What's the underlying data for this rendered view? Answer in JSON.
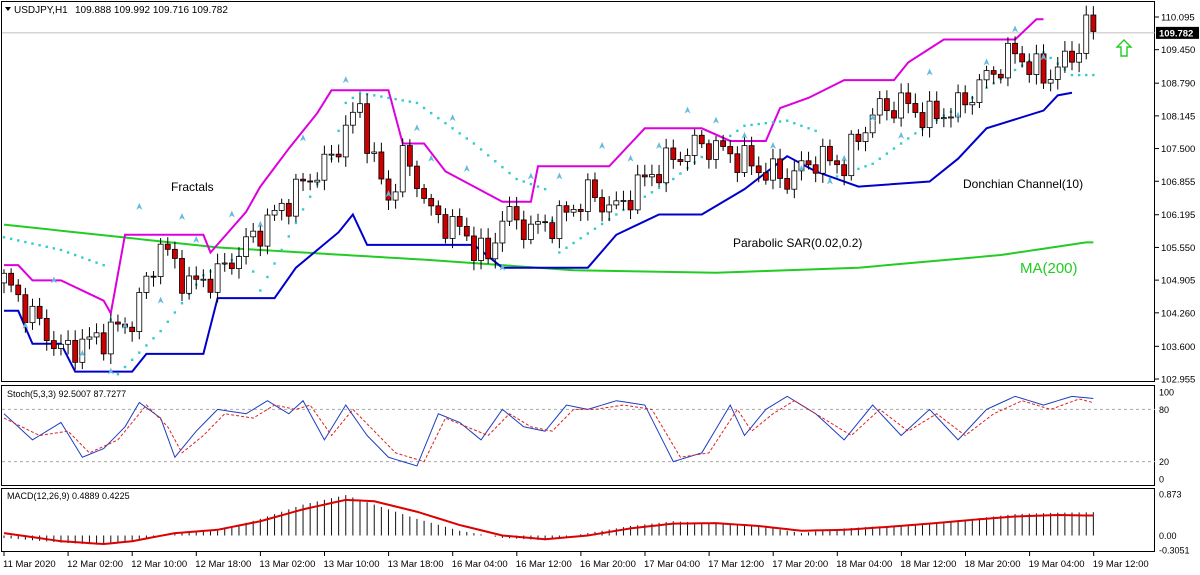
{
  "header": {
    "symbol": "USDJPY,H1",
    "ohlc": "109.888 109.992 109.716 109.782"
  },
  "annotations": {
    "fractals": "Fractals",
    "donchian": "Donchian Channel(10)",
    "sar": "Parabolic SAR(0.02,0.2)",
    "ma": "MA(200)"
  },
  "stoch": {
    "label": "Stoch(5,3,3) 92.5007 87.7277"
  },
  "macd": {
    "label": "MACD(12,26,9) 0.4889 0.4225"
  },
  "colors": {
    "bull": "#ffffff",
    "bear": "#cc0000",
    "donchian_upper": "#dd00dd",
    "donchian_lower": "#0000cc",
    "sar": "#33cccc",
    "ma": "#22cc22",
    "fractal": "#66bbdd",
    "stoch_main": "#1f3fbf",
    "stoch_signal": "#dd2222",
    "macd_hist": "#111111",
    "macd_signal": "#dd0000",
    "current_price_bg": "#000000",
    "arrow": "#22cc22"
  },
  "chart_data": {
    "type": "candlestick",
    "price_axis": {
      "ticks": [
        "110.095",
        "109.450",
        "108.790",
        "108.145",
        "107.500",
        "106.855",
        "106.195",
        "105.550",
        "104.905",
        "104.260",
        "103.600",
        "102.955"
      ],
      "current": "109.782",
      "range": [
        102.955,
        110.095
      ]
    },
    "x_axis": {
      "labels": [
        "11 Mar 2020",
        "12 Mar 02:00",
        "12 Mar 10:00",
        "12 Mar 18:00",
        "13 Mar 02:00",
        "13 Mar 10:00",
        "13 Mar 18:00",
        "16 Mar 04:00",
        "16 Mar 12:00",
        "16 Mar 20:00",
        "17 Mar 04:00",
        "17 Mar 12:00",
        "17 Mar 20:00",
        "18 Mar 04:00",
        "18 Mar 12:00",
        "18 Mar 20:00",
        "19 Mar 04:00",
        "19 Mar 12:00"
      ]
    },
    "candle_anchors": [
      [
        0,
        104.9
      ],
      [
        8,
        103.5
      ],
      [
        14,
        103.8
      ],
      [
        18,
        104.1
      ],
      [
        22,
        105.6
      ],
      [
        26,
        104.8
      ],
      [
        30,
        105.0
      ],
      [
        34,
        105.6
      ],
      [
        38,
        106.2
      ],
      [
        42,
        106.8
      ],
      [
        46,
        107.3
      ],
      [
        48,
        107.9
      ],
      [
        50,
        108.3
      ],
      [
        52,
        107.2
      ],
      [
        54,
        106.5
      ],
      [
        56,
        107.3
      ],
      [
        58,
        106.9
      ],
      [
        60,
        106.2
      ],
      [
        64,
        105.9
      ],
      [
        68,
        105.3
      ],
      [
        70,
        106.2
      ],
      [
        74,
        105.9
      ],
      [
        78,
        106.1
      ],
      [
        82,
        106.6
      ],
      [
        86,
        106.3
      ],
      [
        90,
        106.9
      ],
      [
        94,
        107.3
      ],
      [
        98,
        107.6
      ],
      [
        102,
        107.4
      ],
      [
        106,
        107.1
      ],
      [
        110,
        106.9
      ],
      [
        114,
        107.3
      ],
      [
        118,
        107.2
      ],
      [
        122,
        108.2
      ],
      [
        126,
        108.4
      ],
      [
        130,
        108.1
      ],
      [
        134,
        108.3
      ],
      [
        138,
        108.9
      ],
      [
        142,
        109.4
      ],
      [
        146,
        108.9
      ],
      [
        148,
        109.1
      ],
      [
        150,
        109.3
      ],
      [
        152,
        109.9
      ],
      [
        153,
        109.78
      ]
    ],
    "donchian_upper_anchors": [
      [
        0,
        105.2
      ],
      [
        2,
        105.2
      ],
      [
        4,
        104.9
      ],
      [
        8,
        104.9
      ],
      [
        14,
        104.5
      ],
      [
        15,
        104.25
      ],
      [
        17,
        105.8
      ],
      [
        28,
        105.8
      ],
      [
        29,
        105.45
      ],
      [
        34,
        106.25
      ],
      [
        36,
        106.75
      ],
      [
        40,
        107.5
      ],
      [
        44,
        108.2
      ],
      [
        46,
        108.65
      ],
      [
        54,
        108.65
      ],
      [
        56,
        107.6
      ],
      [
        59,
        107.6
      ],
      [
        62,
        107.05
      ],
      [
        70,
        106.45
      ],
      [
        74,
        106.45
      ],
      [
        75,
        107.15
      ],
      [
        85,
        107.15
      ],
      [
        90,
        107.9
      ],
      [
        98,
        107.9
      ],
      [
        102,
        107.65
      ],
      [
        107,
        107.65
      ],
      [
        109,
        108.3
      ],
      [
        113,
        108.5
      ],
      [
        118,
        108.85
      ],
      [
        125,
        108.85
      ],
      [
        127,
        109.2
      ],
      [
        132,
        109.65
      ],
      [
        142,
        109.65
      ],
      [
        145,
        110.05
      ],
      [
        146,
        110.05
      ]
    ],
    "donchian_lower_anchors": [
      [
        0,
        104.3
      ],
      [
        2,
        104.3
      ],
      [
        4,
        103.65
      ],
      [
        8,
        103.65
      ],
      [
        10,
        103.1
      ],
      [
        18,
        103.1
      ],
      [
        20,
        103.45
      ],
      [
        28,
        103.45
      ],
      [
        30,
        104.55
      ],
      [
        38,
        104.55
      ],
      [
        41,
        105.15
      ],
      [
        47,
        105.85
      ],
      [
        49,
        106.2
      ],
      [
        51,
        105.6
      ],
      [
        66,
        105.6
      ],
      [
        70,
        105.15
      ],
      [
        82,
        105.15
      ],
      [
        86,
        105.8
      ],
      [
        92,
        106.2
      ],
      [
        98,
        106.2
      ],
      [
        104,
        106.7
      ],
      [
        110,
        107.35
      ],
      [
        114,
        107.05
      ],
      [
        120,
        106.75
      ],
      [
        130,
        106.85
      ],
      [
        134,
        107.3
      ],
      [
        138,
        107.9
      ],
      [
        146,
        108.25
      ],
      [
        148,
        108.55
      ],
      [
        150,
        108.6
      ]
    ],
    "sar_anchors": [
      [
        0,
        105.75
      ],
      [
        8,
        105.5
      ],
      [
        14,
        105.2
      ],
      [
        16,
        103.05
      ],
      [
        22,
        103.9
      ],
      [
        28,
        105.0
      ],
      [
        34,
        105.45
      ],
      [
        36,
        104.7
      ],
      [
        42,
        106.3
      ],
      [
        46,
        107.3
      ],
      [
        48,
        108.4
      ],
      [
        50,
        108.6
      ],
      [
        58,
        108.4
      ],
      [
        66,
        107.6
      ],
      [
        72,
        106.9
      ],
      [
        76,
        106.7
      ],
      [
        78,
        105.45
      ],
      [
        86,
        106.2
      ],
      [
        94,
        106.9
      ],
      [
        100,
        107.55
      ],
      [
        104,
        107.95
      ],
      [
        110,
        108.05
      ],
      [
        114,
        107.85
      ],
      [
        116,
        106.9
      ],
      [
        122,
        107.2
      ],
      [
        128,
        107.8
      ],
      [
        132,
        108.15
      ],
      [
        134,
        108.3
      ],
      [
        138,
        108.7
      ],
      [
        146,
        109.4
      ],
      [
        150,
        108.95
      ]
    ],
    "ma_anchors": [
      [
        0,
        106.0
      ],
      [
        30,
        105.55
      ],
      [
        60,
        105.3
      ],
      [
        80,
        105.1
      ],
      [
        100,
        105.05
      ],
      [
        120,
        105.15
      ],
      [
        140,
        105.4
      ],
      [
        152,
        105.65
      ]
    ],
    "fractal_points": [
      [
        3,
        104.0
      ],
      [
        7,
        104.9
      ],
      [
        11,
        103.45
      ],
      [
        15,
        103.1
      ],
      [
        17,
        104.0
      ],
      [
        19,
        106.35
      ],
      [
        22,
        104.5
      ],
      [
        25,
        106.15
      ],
      [
        27,
        105.7
      ],
      [
        32,
        106.2
      ],
      [
        36,
        106.0
      ],
      [
        42,
        107.7
      ],
      [
        48,
        108.85
      ],
      [
        54,
        106.6
      ],
      [
        58,
        107.9
      ],
      [
        60,
        107.3
      ],
      [
        63,
        108.1
      ],
      [
        65,
        107.1
      ],
      [
        70,
        105.15
      ],
      [
        74,
        106.95
      ],
      [
        78,
        106.95
      ],
      [
        84,
        107.55
      ],
      [
        88,
        107.3
      ],
      [
        92,
        107.55
      ],
      [
        96,
        108.25
      ],
      [
        100,
        108.05
      ],
      [
        104,
        107.75
      ],
      [
        108,
        107.55
      ],
      [
        112,
        107.1
      ],
      [
        116,
        106.85
      ],
      [
        118,
        107.3
      ],
      [
        122,
        108.1
      ],
      [
        126,
        107.75
      ],
      [
        130,
        109.0
      ],
      [
        134,
        108.15
      ],
      [
        138,
        109.2
      ],
      [
        142,
        109.85
      ],
      [
        146,
        109.3
      ]
    ],
    "stochastic": {
      "levels": [
        "100",
        "80",
        "20",
        "0"
      ],
      "main_anchors": [
        [
          0,
          75
        ],
        [
          4,
          45
        ],
        [
          8,
          65
        ],
        [
          11,
          25
        ],
        [
          14,
          35
        ],
        [
          17,
          60
        ],
        [
          19,
          88
        ],
        [
          22,
          70
        ],
        [
          24,
          25
        ],
        [
          27,
          55
        ],
        [
          30,
          80
        ],
        [
          34,
          75
        ],
        [
          37,
          90
        ],
        [
          40,
          75
        ],
        [
          42,
          90
        ],
        [
          45,
          45
        ],
        [
          48,
          85
        ],
        [
          51,
          50
        ],
        [
          54,
          25
        ],
        [
          58,
          15
        ],
        [
          61,
          75
        ],
        [
          64,
          65
        ],
        [
          67,
          45
        ],
        [
          70,
          80
        ],
        [
          73,
          60
        ],
        [
          76,
          55
        ],
        [
          79,
          85
        ],
        [
          82,
          80
        ],
        [
          86,
          90
        ],
        [
          90,
          85
        ],
        [
          94,
          20
        ],
        [
          98,
          30
        ],
        [
          102,
          85
        ],
        [
          104,
          50
        ],
        [
          107,
          80
        ],
        [
          110,
          95
        ],
        [
          114,
          75
        ],
        [
          118,
          45
        ],
        [
          122,
          85
        ],
        [
          126,
          50
        ],
        [
          130,
          80
        ],
        [
          134,
          45
        ],
        [
          138,
          80
        ],
        [
          142,
          95
        ],
        [
          146,
          85
        ],
        [
          150,
          95
        ],
        [
          153,
          92.5
        ]
      ],
      "signal_anchors": [
        [
          0,
          70
        ],
        [
          5,
          50
        ],
        [
          9,
          55
        ],
        [
          12,
          30
        ],
        [
          16,
          45
        ],
        [
          20,
          85
        ],
        [
          23,
          60
        ],
        [
          25,
          30
        ],
        [
          28,
          50
        ],
        [
          31,
          75
        ],
        [
          35,
          70
        ],
        [
          38,
          85
        ],
        [
          41,
          80
        ],
        [
          43,
          85
        ],
        [
          46,
          50
        ],
        [
          49,
          80
        ],
        [
          52,
          55
        ],
        [
          55,
          30
        ],
        [
          59,
          20
        ],
        [
          62,
          70
        ],
        [
          65,
          60
        ],
        [
          68,
          50
        ],
        [
          71,
          75
        ],
        [
          74,
          60
        ],
        [
          77,
          55
        ],
        [
          80,
          80
        ],
        [
          83,
          80
        ],
        [
          87,
          85
        ],
        [
          91,
          80
        ],
        [
          95,
          25
        ],
        [
          99,
          30
        ],
        [
          103,
          80
        ],
        [
          105,
          55
        ],
        [
          108,
          75
        ],
        [
          111,
          90
        ],
        [
          115,
          70
        ],
        [
          119,
          50
        ],
        [
          123,
          80
        ],
        [
          127,
          55
        ],
        [
          131,
          75
        ],
        [
          135,
          50
        ],
        [
          139,
          75
        ],
        [
          143,
          90
        ],
        [
          147,
          80
        ],
        [
          151,
          92
        ],
        [
          153,
          87.7
        ]
      ]
    },
    "macd": {
      "levels": [
        "0.873",
        "0.00",
        "-0.3051"
      ],
      "range": [
        -0.3051,
        0.873
      ],
      "hist_anchors": [
        [
          0,
          -0.05
        ],
        [
          8,
          -0.15
        ],
        [
          14,
          -0.2
        ],
        [
          18,
          -0.12
        ],
        [
          24,
          0.05
        ],
        [
          30,
          0.1
        ],
        [
          36,
          0.35
        ],
        [
          42,
          0.65
        ],
        [
          48,
          0.85
        ],
        [
          52,
          0.65
        ],
        [
          58,
          0.35
        ],
        [
          64,
          0.1
        ],
        [
          70,
          -0.05
        ],
        [
          76,
          -0.1
        ],
        [
          82,
          0.05
        ],
        [
          88,
          0.2
        ],
        [
          94,
          0.3
        ],
        [
          100,
          0.25
        ],
        [
          106,
          0.2
        ],
        [
          112,
          0.05
        ],
        [
          118,
          0.15
        ],
        [
          124,
          0.2
        ],
        [
          130,
          0.25
        ],
        [
          136,
          0.35
        ],
        [
          142,
          0.45
        ],
        [
          148,
          0.48
        ],
        [
          153,
          0.49
        ]
      ],
      "signal_anchors": [
        [
          0,
          0.05
        ],
        [
          8,
          -0.12
        ],
        [
          14,
          -0.18
        ],
        [
          18,
          -0.12
        ],
        [
          24,
          0.05
        ],
        [
          30,
          0.12
        ],
        [
          36,
          0.3
        ],
        [
          42,
          0.55
        ],
        [
          48,
          0.75
        ],
        [
          52,
          0.72
        ],
        [
          58,
          0.5
        ],
        [
          64,
          0.22
        ],
        [
          70,
          0.0
        ],
        [
          76,
          -0.08
        ],
        [
          82,
          0.0
        ],
        [
          88,
          0.15
        ],
        [
          94,
          0.25
        ],
        [
          100,
          0.26
        ],
        [
          106,
          0.2
        ],
        [
          112,
          0.1
        ],
        [
          118,
          0.12
        ],
        [
          124,
          0.18
        ],
        [
          130,
          0.25
        ],
        [
          136,
          0.33
        ],
        [
          142,
          0.4
        ],
        [
          148,
          0.43
        ],
        [
          153,
          0.42
        ]
      ]
    }
  }
}
